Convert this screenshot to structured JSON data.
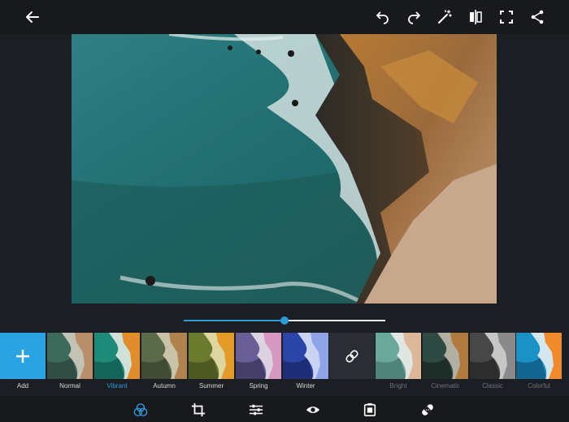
{
  "colors": {
    "accent": "#2d9ad9",
    "add_tile": "#2aa3e3",
    "bg": "#1b1e23",
    "bar": "#17191d"
  },
  "topbar": {
    "icons": [
      "back-arrow-icon",
      "undo-icon",
      "redo-icon",
      "auto-fix-wand-icon",
      "compare-icon",
      "fullscreen-icon",
      "share-icon"
    ]
  },
  "adjust_slider": {
    "value": 0.5
  },
  "filters": [
    {
      "label": "Add",
      "kind": "add"
    },
    {
      "label": "Normal",
      "kind": "thumb",
      "tint": "none"
    },
    {
      "label": "Vibrant",
      "kind": "thumb",
      "tint": "vibrant",
      "selected": true
    },
    {
      "label": "Autumn",
      "kind": "thumb",
      "tint": "autumn"
    },
    {
      "label": "Summer",
      "kind": "thumb",
      "tint": "summer"
    },
    {
      "label": "Spring",
      "kind": "thumb",
      "tint": "spring"
    },
    {
      "label": "Winter",
      "kind": "thumb",
      "tint": "winter"
    },
    {
      "label": "",
      "kind": "link"
    },
    {
      "label": "Bright",
      "kind": "thumb",
      "tint": "bright"
    },
    {
      "label": "Cinematic",
      "kind": "thumb",
      "tint": "cinematic"
    },
    {
      "label": "Classic",
      "kind": "thumb",
      "tint": "classic"
    },
    {
      "label": "Colorful",
      "kind": "thumb",
      "tint": "colorful"
    }
  ],
  "bottombar": {
    "tools": [
      "looks-filter-icon",
      "crop-icon",
      "adjustments-sliders-icon",
      "red-eye-icon",
      "frame-border-icon",
      "spot-heal-bandage-icon"
    ],
    "active_tool": "looks-filter-icon"
  }
}
